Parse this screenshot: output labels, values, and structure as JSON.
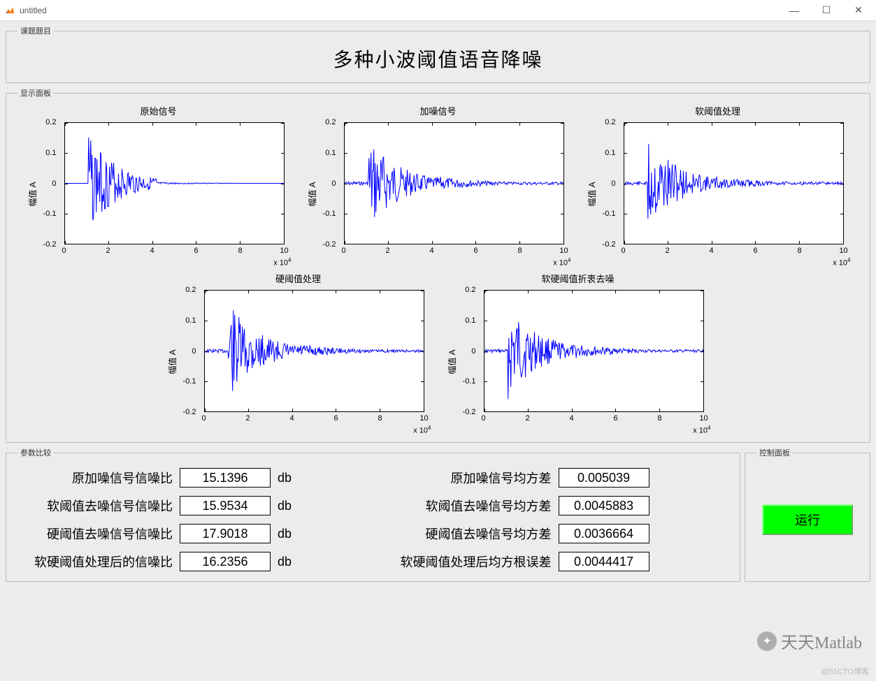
{
  "window": {
    "title": "untitled",
    "minimize": "—",
    "maximize": "☐",
    "close": "✕"
  },
  "groups": {
    "topic": "课题题目",
    "display": "显示面板",
    "params": "参数比较",
    "control": "控制面板"
  },
  "main_title": "多种小波阈值语音降噪",
  "axis": {
    "ylabel": "幅值 A",
    "yticks": [
      "0.2",
      "0.1",
      "0",
      "-0.1",
      "-0.2"
    ],
    "xticks": [
      "0",
      "2",
      "4",
      "6",
      "8",
      "10"
    ],
    "xexp_html": "x 10<sup>4</sup>"
  },
  "chart_data": [
    {
      "id": "orig",
      "title": "原始信号",
      "ylabel": "幅值 A",
      "xlim": [
        0,
        100000
      ],
      "ylim": [
        -0.2,
        0.2
      ],
      "type": "waveform"
    },
    {
      "id": "noisy",
      "title": "加噪信号",
      "ylabel": "幅值 A",
      "xlim": [
        0,
        100000
      ],
      "ylim": [
        -0.2,
        0.2
      ],
      "type": "waveform"
    },
    {
      "id": "soft",
      "title": "软阈值处理",
      "ylabel": "幅值 A",
      "xlim": [
        0,
        100000
      ],
      "ylim": [
        -0.2,
        0.2
      ],
      "type": "waveform"
    },
    {
      "id": "hard",
      "title": "硬阈值处理",
      "ylabel": "幅值 A",
      "xlim": [
        0,
        100000
      ],
      "ylim": [
        -0.2,
        0.2
      ],
      "type": "waveform"
    },
    {
      "id": "sh",
      "title": "软硬阈值折衷去噪",
      "ylabel": "幅值 A",
      "xlim": [
        0,
        100000
      ],
      "ylim": [
        -0.2,
        0.2
      ],
      "type": "waveform"
    }
  ],
  "params": {
    "snr": [
      {
        "label": "原加噪信号信噪比",
        "value": "15.1396",
        "unit": "db"
      },
      {
        "label": "软阈值去噪信号信噪比",
        "value": "15.9534",
        "unit": "db"
      },
      {
        "label": "硬阈值去噪信号信噪比",
        "value": "17.9018",
        "unit": "db"
      },
      {
        "label": "软硬阈值处理后的信噪比",
        "value": "16.2356",
        "unit": "db"
      }
    ],
    "mse": [
      {
        "label": "原加噪信号均方差",
        "value": "0.005039"
      },
      {
        "label": "软阈值去噪信号均方差",
        "value": "0.0045883"
      },
      {
        "label": "硬阈值去噪信号均方差",
        "value": "0.0036664"
      },
      {
        "label": "软硬阈值处理后均方根误差",
        "value": "0.0044417"
      }
    ]
  },
  "button": {
    "run": "运行"
  },
  "watermark": "天天Matlab",
  "attribution": "@51CTO博客"
}
